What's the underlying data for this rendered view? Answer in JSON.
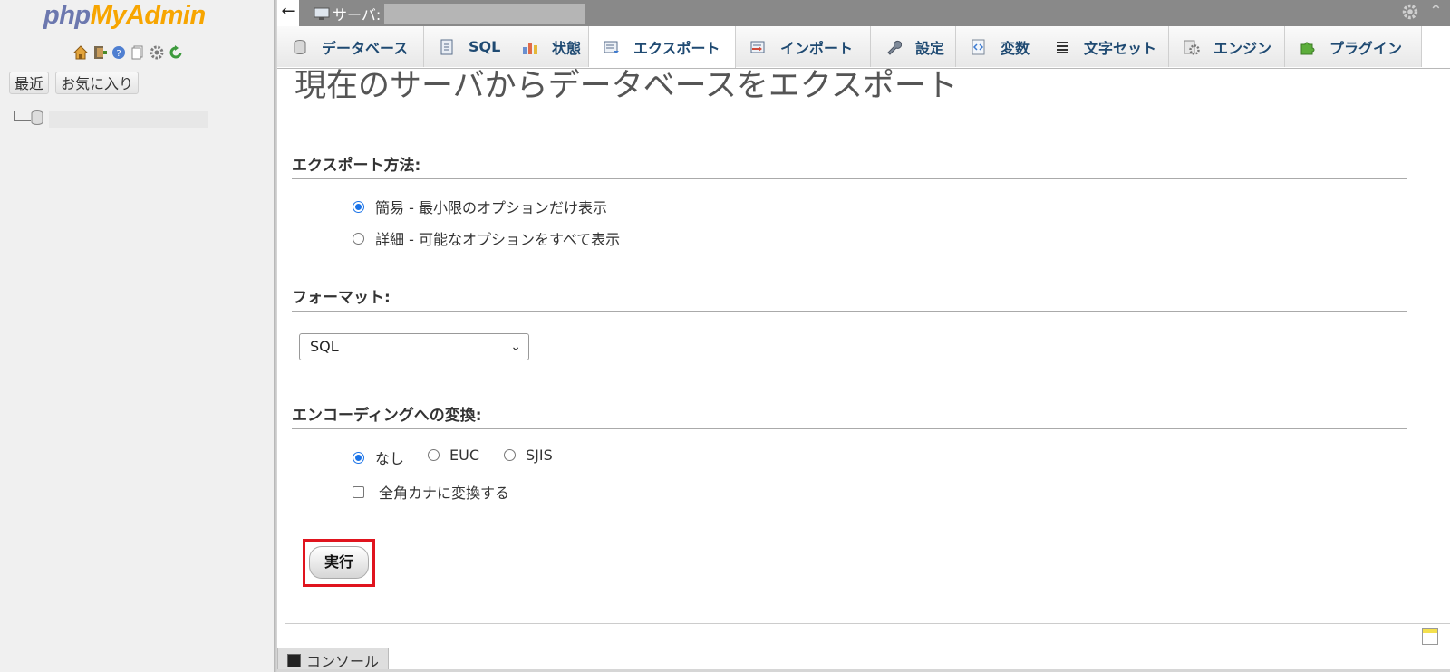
{
  "navigation": {
    "logo_part1": "php",
    "logo_part2": "MyAdmin",
    "recent_label": "最近",
    "favorites_label": "お気に入り",
    "quick_icons": [
      "home-icon",
      "logout-icon",
      "help-icon",
      "docs-icon",
      "settings-gear-icon",
      "reload-icon"
    ]
  },
  "serverbar": {
    "back_arrow": "←",
    "server_label": "サーバ:",
    "collapse_glyph": "⌃"
  },
  "tabs": [
    {
      "label": "データベース",
      "icon": "database-icon"
    },
    {
      "label": "SQL",
      "icon": "sql-icon"
    },
    {
      "label": "状態",
      "icon": "status-chart-icon"
    },
    {
      "label": "エクスポート",
      "icon": "export-icon",
      "active": true
    },
    {
      "label": "インポート",
      "icon": "import-icon"
    },
    {
      "label": "設定",
      "icon": "wrench-icon"
    },
    {
      "label": "変数",
      "icon": "variables-icon"
    },
    {
      "label": "文字セット",
      "icon": "charset-icon"
    },
    {
      "label": "エンジン",
      "icon": "engine-icon"
    },
    {
      "label": "プラグイン",
      "icon": "plugin-icon"
    }
  ],
  "page": {
    "title": "現在のサーバからデータベースをエクスポート"
  },
  "export_method": {
    "heading": "エクスポート方法:",
    "options": [
      {
        "label": "簡易 - 最小限のオプションだけ表示",
        "checked": true
      },
      {
        "label": "詳細 - 可能なオプションをすべて表示",
        "checked": false
      }
    ]
  },
  "format": {
    "heading": "フォーマット:",
    "selected": "SQL",
    "chevron": "⌄"
  },
  "encoding": {
    "heading": "エンコーディングへの変換:",
    "options": [
      {
        "label": "なし",
        "checked": true
      },
      {
        "label": "EUC",
        "checked": false
      },
      {
        "label": "SJIS",
        "checked": false
      }
    ],
    "kana_label": "全角カナに変換する",
    "kana_checked": false
  },
  "actions": {
    "go_label": "実行"
  },
  "console": {
    "label": "コンソール"
  },
  "colors": {
    "logo_php": "#6c78af",
    "logo_myadmin": "#f7a500",
    "tab_text": "#1f4a72",
    "radio_selected": "#1a73e8",
    "highlight_box": "#e0141e",
    "serverbar_bg": "#898989"
  }
}
